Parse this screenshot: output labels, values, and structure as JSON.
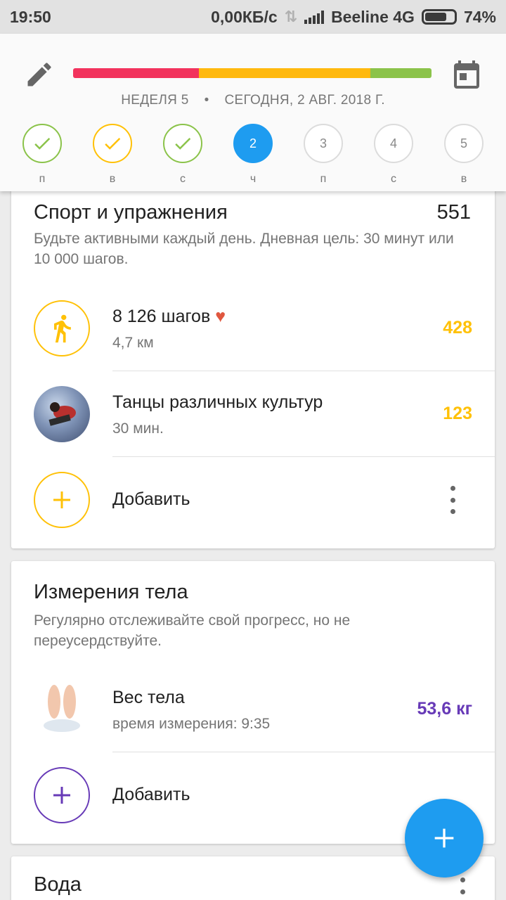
{
  "status_bar": {
    "time": "19:50",
    "speed": "0,00КБ/с",
    "carrier": "Beeline 4G",
    "battery": "74%",
    "battery_level": 0.74
  },
  "header": {
    "week": "НЕДЕЛЯ 5",
    "separator": "•",
    "today": "СЕГОДНЯ, 2 АВГ. 2018 Г.",
    "progress_segments": [
      {
        "color": "#f2335d",
        "fraction": 0.35
      },
      {
        "color": "#ffb90f",
        "fraction": 0.48
      },
      {
        "color": "#8bc34a",
        "fraction": 0.17
      }
    ],
    "days": [
      {
        "label": "п",
        "state": "done",
        "color": "#8bc34a",
        "number": ""
      },
      {
        "label": "в",
        "state": "done",
        "color": "#ffc107",
        "number": ""
      },
      {
        "label": "с",
        "state": "done",
        "color": "#8bc34a",
        "number": ""
      },
      {
        "label": "ч",
        "state": "current",
        "color": "#1e9cf0",
        "number": "2"
      },
      {
        "label": "п",
        "state": "future",
        "color": "#dcdcdc",
        "number": "3"
      },
      {
        "label": "с",
        "state": "future",
        "color": "#dcdcdc",
        "number": "4"
      },
      {
        "label": "в",
        "state": "future",
        "color": "#dcdcdc",
        "number": "5"
      }
    ]
  },
  "sport_card": {
    "title": "Спорт и упражнения",
    "score": "551",
    "subtitle": "Будьте активными каждый день. Дневная цель: 30 минут или 10 000 шагов.",
    "items": [
      {
        "title": "8 126 шагов",
        "subtitle": "4,7 км",
        "value": "428",
        "icon": "walking-icon"
      },
      {
        "title": "Танцы различных культур",
        "subtitle": "30 мин.",
        "value": "123",
        "icon": "dance-photo"
      }
    ],
    "add_label": "Добавить",
    "accent": "#ffc107"
  },
  "body_card": {
    "title": "Измерения тела",
    "subtitle": "Регулярно отслеживайте свой прогресс, но не переусердствуйте.",
    "items": [
      {
        "title": "Вес тела",
        "subtitle": "время измерения: 9:35",
        "value": "53,6 кг",
        "icon": "scale-photo"
      }
    ],
    "add_label": "Добавить",
    "accent": "#673ab7"
  },
  "water_card": {
    "title": "Вода"
  },
  "fab": {
    "icon": "plus-icon",
    "color": "#1e9cf0"
  }
}
